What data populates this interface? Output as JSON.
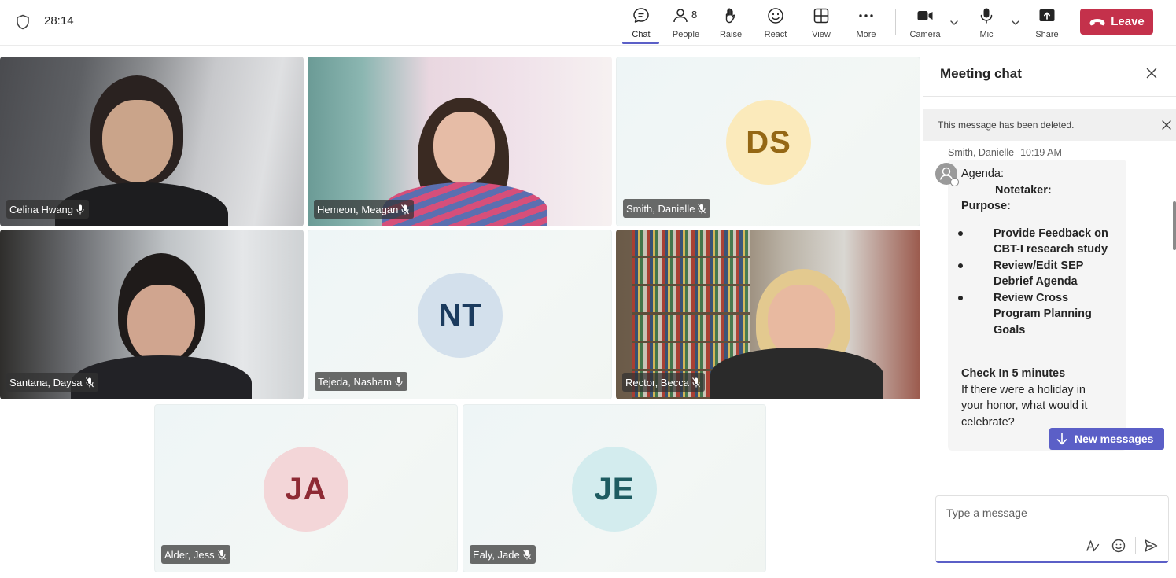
{
  "header": {
    "timer": "28:14",
    "tools": [
      {
        "label": "Chat",
        "icon": "chat-icon"
      },
      {
        "label": "People",
        "icon": "people-icon"
      },
      {
        "label": "Raise",
        "icon": "raise-hand-icon"
      },
      {
        "label": "React",
        "icon": "react-icon"
      },
      {
        "label": "View",
        "icon": "view-icon"
      },
      {
        "label": "More",
        "icon": "more-icon"
      },
      {
        "label": "Camera",
        "icon": "camera-icon"
      },
      {
        "label": "Mic",
        "icon": "mic-icon"
      },
      {
        "label": "Share",
        "icon": "share-icon"
      }
    ],
    "people_count": "8",
    "leave_label": "Leave",
    "colors": {
      "accent": "#5b5fc7",
      "leave": "#c4314b"
    }
  },
  "participants": [
    {
      "name": "Celina Hwang",
      "video": true
    },
    {
      "name": "Hemeon, Meagan",
      "video": true
    },
    {
      "name": "Smith, Danielle",
      "video": false,
      "initials": "DS",
      "avatar_bg": "#fbeabb",
      "avatar_fg": "#946714"
    },
    {
      "name": "Santana, Daysa",
      "video": true
    },
    {
      "name": "Tejeda, Nasham",
      "video": false,
      "initials": "NT",
      "avatar_bg": "#d3e0ec",
      "avatar_fg": "#1b3b5e"
    },
    {
      "name": "Rector, Becca",
      "video": true
    },
    {
      "name": "Alder, Jess",
      "video": false,
      "initials": "JA",
      "avatar_bg": "#f3d6d8",
      "avatar_fg": "#8e2a34"
    },
    {
      "name": "Ealy, Jade",
      "video": false,
      "initials": "JE",
      "avatar_bg": "#d3ecee",
      "avatar_fg": "#1e5c61"
    }
  ],
  "chat": {
    "title": "Meeting chat",
    "deleted_notice": "This message has been deleted.",
    "message": {
      "sender": "Smith, Danielle",
      "time": "10:19 AM",
      "agenda": "Agenda:",
      "notetaker": "Notetaker:",
      "purpose": "Purpose:",
      "bullets": [
        [
          "Provide Feedback on",
          "CBT-I research study"
        ],
        [
          "Review/Edit SEP",
          "Debrief Agenda"
        ],
        [
          "Review Cross",
          "Program Planning",
          "Goals"
        ]
      ],
      "checkin": "Check In 5 minutes",
      "question": [
        "If there were a holiday in",
        "your honor, what would it",
        "celebrate?"
      ]
    },
    "new_messages": "New messages",
    "composer_placeholder": "Type a message"
  }
}
